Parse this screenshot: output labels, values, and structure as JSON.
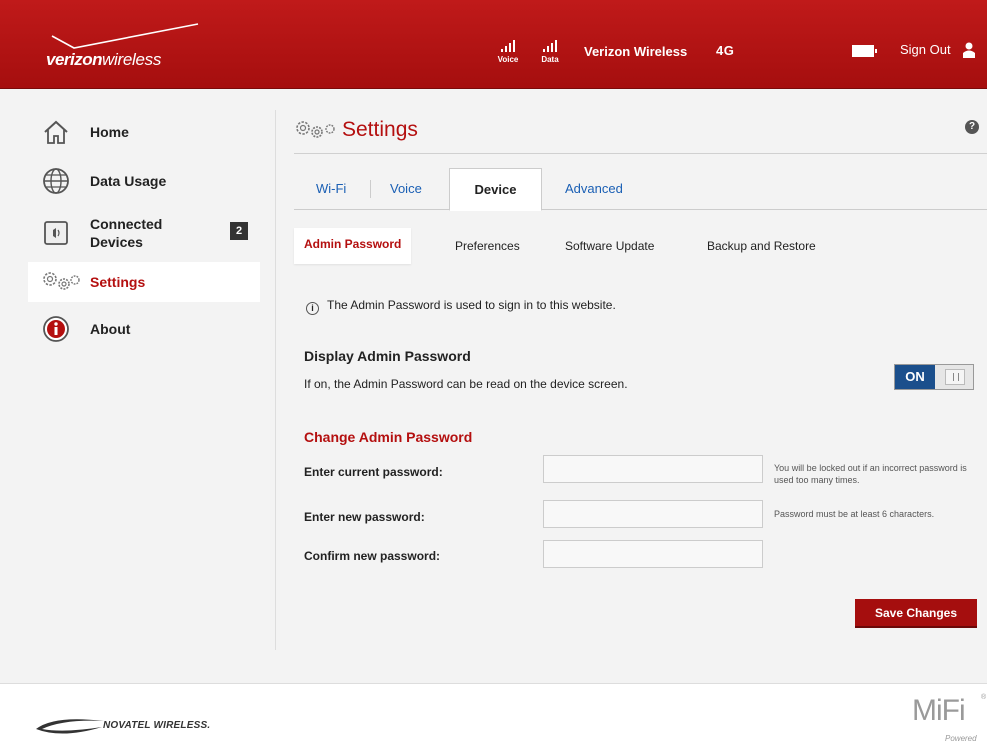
{
  "header": {
    "logo_brand": "verizon",
    "logo_suffix": "wireless",
    "voice_label": "Voice",
    "data_label": "Data",
    "carrier": "Verizon Wireless",
    "network": "4G",
    "signout_label": "Sign Out"
  },
  "sidebar": {
    "items": [
      {
        "label": "Home",
        "icon": "home-icon"
      },
      {
        "label": "Data Usage",
        "icon": "globe-icon"
      },
      {
        "label": "Connected\nDevices",
        "icon": "speaker-icon",
        "badge": "2"
      },
      {
        "label": "Settings",
        "icon": "gears-icon",
        "active": true
      },
      {
        "label": "About",
        "icon": "info-icon"
      }
    ]
  },
  "main": {
    "title": "Settings",
    "help": "?",
    "tabs": [
      "Wi-Fi",
      "Voice",
      "Device",
      "Advanced"
    ],
    "active_tab": "Device",
    "subtabs": [
      "Admin Password",
      "Preferences",
      "Software Update",
      "Backup and Restore"
    ],
    "active_subtab": "Admin Password",
    "info_text": "The Admin Password is used to sign in to this website.",
    "display_heading": "Display Admin Password",
    "display_desc": "If on, the Admin Password can be read on the device screen.",
    "toggle_state": "ON",
    "change_heading": "Change Admin Password",
    "fields": [
      {
        "label": "Enter current password:",
        "value": "",
        "hint": "You will be locked out if an incorrect password is used too many times."
      },
      {
        "label": "Enter new password:",
        "value": "",
        "hint": "Password must be at least 6 characters."
      },
      {
        "label": "Confirm new password:",
        "value": "",
        "hint": ""
      }
    ],
    "save_label": "Save Changes"
  },
  "footer": {
    "novatel": "NOVATEL WIRELESS.",
    "mifi": "MiFi",
    "mifi_reg": "®",
    "powered": "Powered"
  },
  "colors": {
    "brand_red": "#b40f0f",
    "header_red": "#a50e0e",
    "link_blue": "#1a5fb4",
    "toggle_blue": "#1b4f8c"
  }
}
